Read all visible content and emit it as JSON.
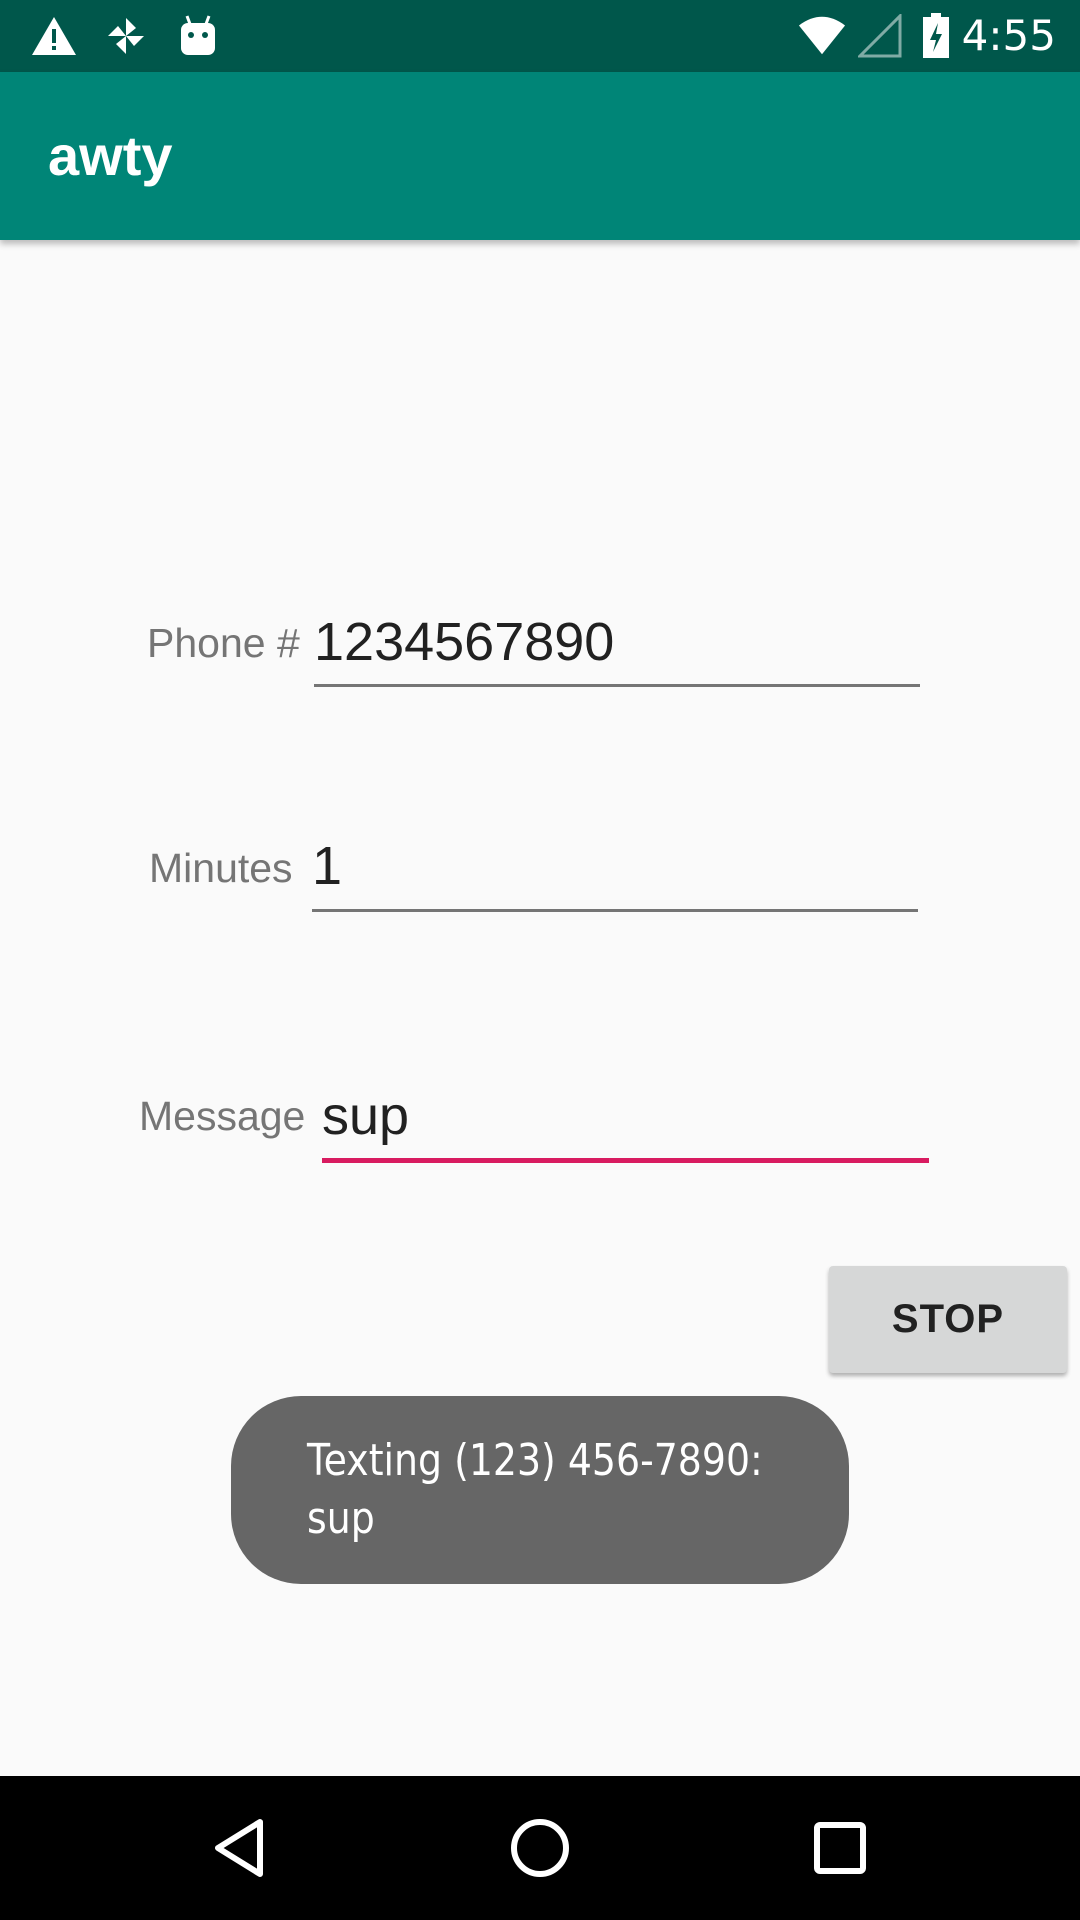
{
  "status_bar": {
    "time": "4:55",
    "icons": [
      "warning-icon",
      "pinwheel-icon",
      "android-icon",
      "wifi-icon",
      "signal-icon",
      "battery-charging-icon"
    ]
  },
  "app_bar": {
    "title": "awty"
  },
  "form": {
    "phone": {
      "label": "Phone #",
      "value": "1234567890"
    },
    "minutes": {
      "label": "Minutes",
      "value": "1"
    },
    "message": {
      "label": "Message",
      "value": "sup"
    },
    "stop_label": "STOP"
  },
  "toast": {
    "text": "Texting (123) 456-7890: sup"
  },
  "nav_bar": {
    "buttons": [
      "back-icon",
      "home-icon",
      "recents-icon"
    ]
  },
  "colors": {
    "status_bar": "#00574b",
    "app_bar": "#008577",
    "accent": "#d81b60",
    "background": "#fafafa",
    "toast": "#666666"
  }
}
